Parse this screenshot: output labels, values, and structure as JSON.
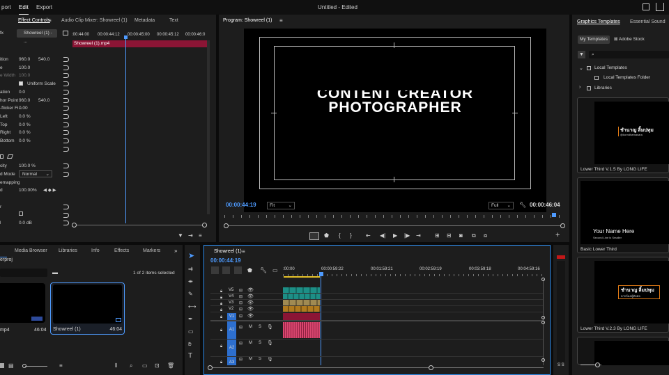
{
  "menu": {
    "items": [
      "port",
      "Edit",
      "Export"
    ],
    "title": "Untitled - Edited"
  },
  "effect_controls": {
    "tabs": [
      "Effect Controls",
      "Audio Clip Mixer: Showreel (1)",
      "Metadata",
      "Text"
    ],
    "source": "Showreel (1) - ...",
    "clip_label": "Showreel (1).mp4",
    "timecodes": [
      ":00:44:00",
      "00:00:44:12",
      "00:00:45:00",
      "00:00:45:12",
      "00:00:46:0"
    ],
    "props": [
      {
        "label": "ition",
        "v1": "960.0",
        "v2": "540.0"
      },
      {
        "label": "e",
        "v1": "100.0",
        "v2": ""
      },
      {
        "label": "e Width",
        "v1": "100.0",
        "v2": ""
      },
      {
        "label": "",
        "v1": "Uniform Scale",
        "v2": ""
      },
      {
        "label": "ation",
        "v1": "0.0",
        "v2": ""
      },
      {
        "label": "hor Point",
        "v1": "960.0",
        "v2": "540.0"
      },
      {
        "label": "-flicker Fi...",
        "v1": "0.00",
        "v2": ""
      },
      {
        "label": "Left",
        "v1": "0.0 %",
        "v2": ""
      },
      {
        "label": "Top",
        "v1": "0.0 %",
        "v2": ""
      },
      {
        "label": "Right",
        "v1": "0.0 %",
        "v2": ""
      },
      {
        "label": "Bottom",
        "v1": "0.0 %",
        "v2": ""
      }
    ],
    "opacity_label": "city",
    "opacity": "100.0 %",
    "blend_label": "d Mode",
    "blend": "Normal",
    "remap": "emapping",
    "speed_label": "d",
    "speed": "100.00%",
    "volume": "0.0 dB"
  },
  "program": {
    "title": "Program: Showreel (1)",
    "text_line1": "CONTENT CREATOR",
    "text_line2": "PHOTOGRAPHER",
    "timecode": "00:00:44:19",
    "fit": "Fit",
    "quality": "Full",
    "duration": "00:00:46:04"
  },
  "project": {
    "tabs": [
      "Media Browser",
      "Libraries",
      "Info",
      "Effects",
      "Markers"
    ],
    "name": "erproj",
    "count": "1 of 2 items selected",
    "items": [
      {
        "name": "mp4",
        "dur": "46:04"
      },
      {
        "name": "Showreel (1)",
        "dur": "46:04"
      }
    ]
  },
  "timeline": {
    "title": "Showreel (1)",
    "timecode": "00:00:44:19",
    "ruler": [
      ":00:00",
      "00:00:59:22",
      "00:01:59:21",
      "00:02:59:19",
      "00:03:59:18",
      "00:04:59:16"
    ],
    "video_tracks": [
      "V5",
      "V4",
      "V3",
      "V2",
      "V1"
    ],
    "audio_tracks": [
      "A1",
      "A2",
      "A3"
    ],
    "m": "M",
    "s": "S"
  },
  "graphics": {
    "tabs": [
      "Graphics Templates",
      "Essential Sound"
    ],
    "subtabs": [
      "My Templates",
      "Adobe Stock"
    ],
    "tree": [
      "Local Templates",
      "Local Templates Folder",
      "Libraries"
    ],
    "templates": [
      {
        "name": "Lower Third V.1.5 By LONG LIFE",
        "thumb_title": "ชำนาญ ลิ้มปทุม",
        "thumb_sub": "@korndhamasara"
      },
      {
        "name": "Basic Lower Third",
        "thumb_title": "Your Name Here",
        "thumb_sub": "Second Line is Smaller"
      },
      {
        "name": "Lower Third V.2.3 By LONG LIFE",
        "thumb_title": "ชำนาญ ลิ้มปทุม",
        "thumb_sub": "ตากล้อง/ผู้ตัดต่อ"
      }
    ]
  },
  "colors": {
    "accent": "#2d8ceb",
    "clip_red": "#8b1535",
    "teal": "#1d8f86",
    "pink": "#d9466f"
  }
}
